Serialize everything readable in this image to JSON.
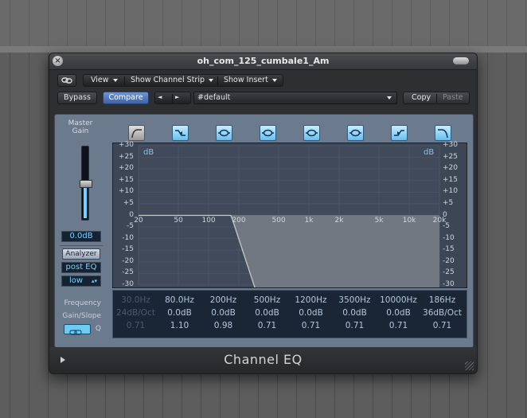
{
  "window": {
    "title": "oh_com_125_cumbale1_Am",
    "plugin_name": "Channel EQ"
  },
  "toolbar": {
    "link_icon": "link-icon",
    "view_label": "View",
    "show_channel_strip_label": "Show Channel Strip",
    "show_insert_label": "Show Insert",
    "bypass_label": "Bypass",
    "compare_label": "Compare",
    "prev_label": "◄",
    "next_label": "►",
    "preset_value": "#default",
    "copy_label": "Copy",
    "paste_label": "Paste"
  },
  "master": {
    "label_line1": "Master",
    "label_line2": "Gain",
    "value": "0.0dB",
    "level": 0.5
  },
  "analyzer": {
    "label": "Analyzer",
    "mode": "post EQ",
    "resolution": "low"
  },
  "graph": {
    "unit_left": "dB",
    "unit_right": "dB",
    "db_left": [
      "+30",
      "+25",
      "+20",
      "+15",
      "+10",
      "+5",
      "0",
      "-5",
      "-10",
      "-15",
      "-20",
      "-25",
      "-30"
    ],
    "db_right": [
      "+30",
      "+25",
      "+20",
      "+15",
      "+10",
      "+5",
      "0",
      "-5",
      "-10",
      "-15",
      "-20",
      "-25",
      "-30"
    ],
    "freq_labels": [
      "20",
      "50",
      "100",
      "200",
      "500",
      "1k",
      "2k",
      "5k",
      "10k",
      "20k"
    ]
  },
  "bands": [
    {
      "icon": "low-cut-icon",
      "active": false
    },
    {
      "icon": "low-shelf-icon",
      "active": true
    },
    {
      "icon": "parametric-band-icon",
      "active": true
    },
    {
      "icon": "parametric-band-icon",
      "active": true
    },
    {
      "icon": "parametric-band-icon",
      "active": true
    },
    {
      "icon": "parametric-band-icon",
      "active": true
    },
    {
      "icon": "high-shelf-icon",
      "active": true
    },
    {
      "icon": "high-cut-icon",
      "active": true
    }
  ],
  "params": {
    "row_labels": {
      "frequency": "Frequency",
      "gain_slope": "Gain/Slope",
      "q": "Q"
    },
    "frequency": [
      "30.0Hz",
      "80.0Hz",
      "200Hz",
      "500Hz",
      "1200Hz",
      "3500Hz",
      "10000Hz",
      "186Hz"
    ],
    "gain_slope": [
      "24dB/Oct",
      "0.0dB",
      "0.0dB",
      "0.0dB",
      "0.0dB",
      "0.0dB",
      "0.0dB",
      "36dB/Oct"
    ],
    "q": [
      "0.71",
      "1.10",
      "0.98",
      "0.71",
      "0.71",
      "0.71",
      "0.71",
      "0.71"
    ]
  },
  "colors": {
    "accent": "#6bd5ff",
    "compare": "#4c74bf",
    "panel": "#6c7a8d",
    "graph_bg": "#3d4655"
  }
}
